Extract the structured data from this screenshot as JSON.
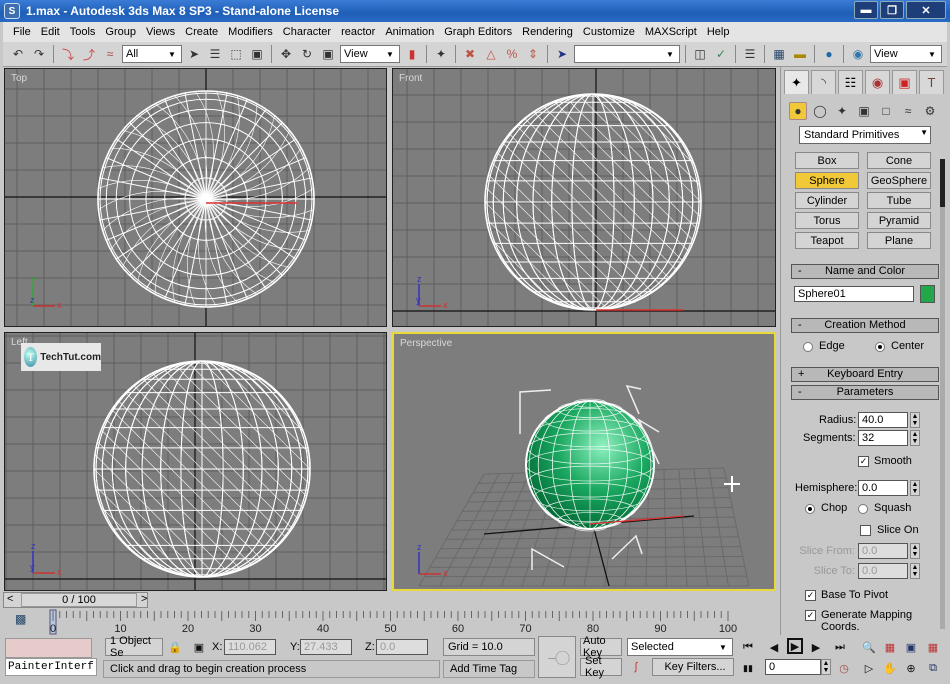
{
  "window": {
    "title": "1.max - Autodesk 3ds Max 8 SP3  - Stand-alone License",
    "controls": [
      "minimize",
      "restore",
      "close"
    ]
  },
  "menu": [
    "File",
    "Edit",
    "Tools",
    "Group",
    "Views",
    "Create",
    "Modifiers",
    "Character",
    "reactor",
    "Animation",
    "Graph Editors",
    "Rendering",
    "Customize",
    "MAXScript",
    "Help"
  ],
  "toolbar": {
    "selection_filter": "All",
    "ref_coord_system": "View",
    "named_selection": "",
    "render_type": "View"
  },
  "viewports": [
    {
      "name": "Top",
      "active": false,
      "axes": [
        "y",
        "z",
        "x"
      ]
    },
    {
      "name": "Front",
      "active": false,
      "axes": [
        "z",
        "y",
        "x"
      ]
    },
    {
      "name": "Left",
      "active": false,
      "axes": [
        "z",
        "y",
        "x"
      ]
    },
    {
      "name": "Perspective",
      "active": true,
      "axes": [
        "z",
        "x"
      ]
    }
  ],
  "watermark": "TechTut.com",
  "command_panel": {
    "tabs": [
      "create",
      "modify",
      "hierarchy",
      "motion",
      "display",
      "utilities"
    ],
    "categories": [
      "geometry",
      "shapes",
      "lights",
      "cameras",
      "helpers",
      "space-warps",
      "systems"
    ],
    "object_type": "Standard Primitives",
    "primitives": [
      "Box",
      "Cone",
      "Sphere",
      "GeoSphere",
      "Cylinder",
      "Tube",
      "Torus",
      "Pyramid",
      "Teapot",
      "Plane"
    ],
    "selected_primitive": "Sphere",
    "rollouts": {
      "name_color": {
        "title": "Name and Color",
        "sign": "-",
        "name": "Sphere01",
        "color": "#22a84a"
      },
      "creation_method": {
        "title": "Creation Method",
        "sign": "-",
        "options": [
          "Edge",
          "Center"
        ],
        "selected": "Center"
      },
      "keyboard_entry": {
        "title": "Keyboard Entry",
        "sign": "+"
      },
      "parameters": {
        "title": "Parameters",
        "sign": "-",
        "radius_label": "Radius:",
        "radius": "40.0",
        "segments_label": "Segments:",
        "segments": "32",
        "smooth_label": "Smooth",
        "smooth": true,
        "hemisphere_label": "Hemisphere:",
        "hemisphere": "0.0",
        "chop_label": "Chop",
        "squash_label": "Squash",
        "hemi_mode": "Chop",
        "slice_on_label": "Slice On",
        "slice_on": false,
        "slice_from_label": "Slice From:",
        "slice_from": "0.0",
        "slice_to_label": "Slice To:",
        "slice_to": "0.0",
        "base_to_pivot_label": "Base To Pivot",
        "base_to_pivot": true,
        "gen_mapping_label": "Generate Mapping Coords.",
        "gen_mapping": true
      }
    }
  },
  "timeline": {
    "slider": "0 / 100",
    "prev": "<",
    "next": ">",
    "ticks": [
      "0",
      "10",
      "20",
      "30",
      "40",
      "50",
      "60",
      "70",
      "80",
      "90",
      "100"
    ],
    "current_frame": 0
  },
  "status": {
    "script_listener": "PainterInterf",
    "selection": "1 Object Se",
    "x_label": "X:",
    "x": "110.062",
    "y_label": "Y:",
    "y": "27.433",
    "z_label": "Z:",
    "z": "0.0",
    "grid": "Grid = 10.0",
    "prompt": "Click and drag to begin creation process",
    "add_time_tag": "Add Time Tag",
    "auto_key": "Auto Key",
    "set_key": "Set Key",
    "key_mode": "Selected",
    "key_filters": "Key Filters...",
    "frame_field": "0"
  }
}
